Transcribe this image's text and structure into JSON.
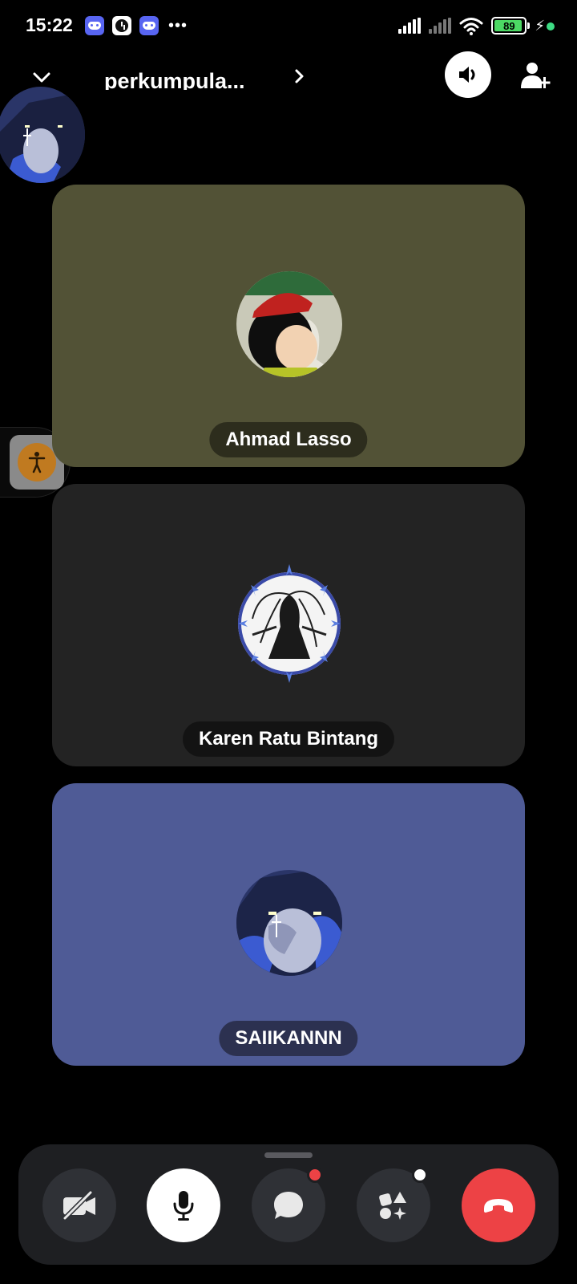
{
  "status_bar": {
    "time": "15:22",
    "battery_level": "89",
    "notification_icons": [
      "discord-icon",
      "clock-icon",
      "discord-icon",
      "more-dots-icon"
    ]
  },
  "header": {
    "channel_name": "perkumpula...",
    "icons": [
      "chevron-down-icon",
      "chevron-right-icon",
      "speaker-icon",
      "add-user-icon"
    ]
  },
  "participants": [
    {
      "name": "Ahmad Lasso",
      "tile_color": "#525236"
    },
    {
      "name": "Karen Ratu Bintang",
      "tile_color": "#232323"
    },
    {
      "name": "SAIIKANNN",
      "tile_color": "#4f5b96"
    }
  ],
  "controls": {
    "buttons": [
      "camera-off-icon",
      "microphone-icon",
      "chat-icon",
      "activities-icon",
      "hang-up-icon"
    ],
    "hangup_color": "#ed4245",
    "chat_badge_color": "#ed4245",
    "activity_badge_color": "#ffffff"
  },
  "accessibility": {
    "icon": "accessibility-icon"
  }
}
